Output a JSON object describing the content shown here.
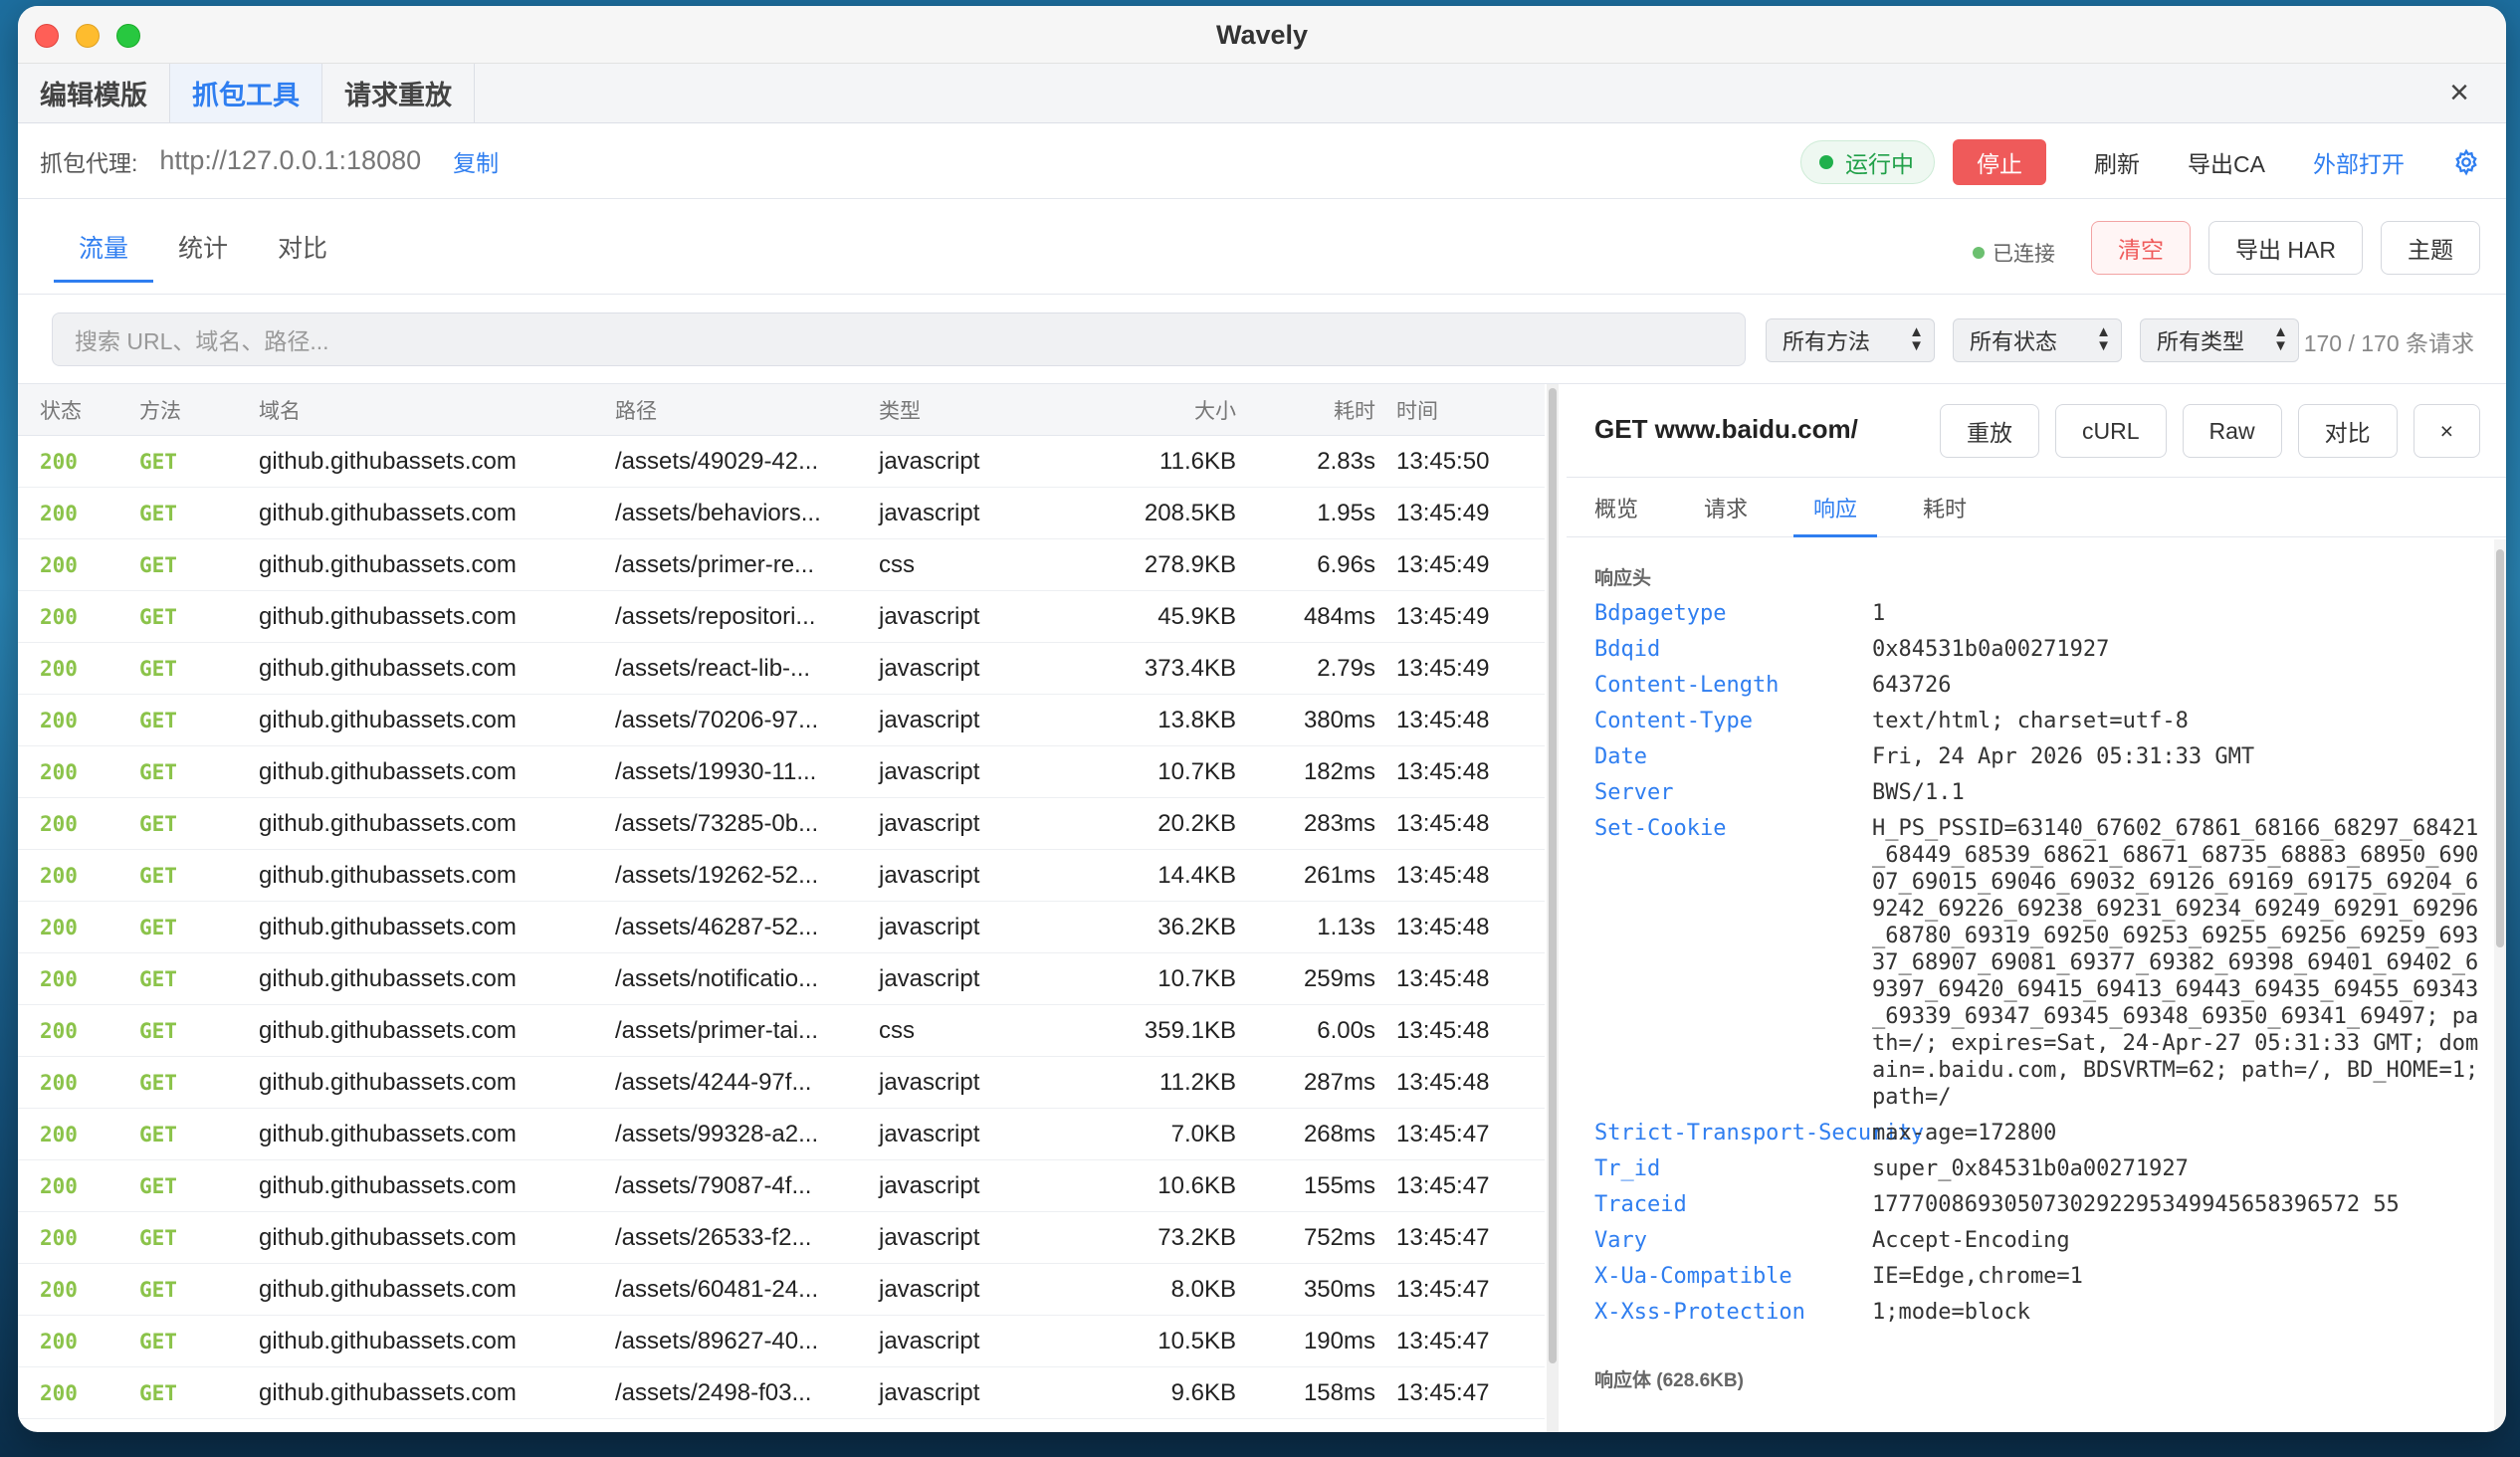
{
  "window": {
    "title": "Wavely"
  },
  "tabs": [
    {
      "label": "编辑模版",
      "active": false
    },
    {
      "label": "抓包工具",
      "active": true
    },
    {
      "label": "请求重放",
      "active": false
    }
  ],
  "proxy": {
    "label": "抓包代理:",
    "url": "http://127.0.0.1:18080",
    "copy_label": "复制",
    "status_label": "运行中",
    "stop_label": "停止",
    "refresh_label": "刷新",
    "export_ca_label": "导出CA",
    "open_external_label": "外部打开",
    "settings_icon": "gear-icon"
  },
  "subtabs": [
    {
      "label": "流量",
      "active": true
    },
    {
      "label": "统计",
      "active": false
    },
    {
      "label": "对比",
      "active": false
    }
  ],
  "toolbar": {
    "connected_label": "已连接",
    "clear_label": "清空",
    "export_har_label": "导出 HAR",
    "theme_label": "主题"
  },
  "filters": {
    "search_placeholder": "搜索 URL、域名、路径...",
    "method": "所有方法",
    "status": "所有状态",
    "type": "所有类型",
    "count_text": "170 / 170 条请求"
  },
  "table": {
    "headers": {
      "status": "状态",
      "method": "方法",
      "domain": "域名",
      "path": "路径",
      "type": "类型",
      "size": "大小",
      "duration": "耗时",
      "time": "时间"
    },
    "rows": [
      {
        "status": "200",
        "method": "GET",
        "domain": "github.githubassets.com",
        "path": "/assets/49029-42...",
        "type": "javascript",
        "size": "11.6KB",
        "duration": "2.83s",
        "time": "13:45:50"
      },
      {
        "status": "200",
        "method": "GET",
        "domain": "github.githubassets.com",
        "path": "/assets/behaviors...",
        "type": "javascript",
        "size": "208.5KB",
        "duration": "1.95s",
        "time": "13:45:49"
      },
      {
        "status": "200",
        "method": "GET",
        "domain": "github.githubassets.com",
        "path": "/assets/primer-re...",
        "type": "css",
        "size": "278.9KB",
        "duration": "6.96s",
        "time": "13:45:49"
      },
      {
        "status": "200",
        "method": "GET",
        "domain": "github.githubassets.com",
        "path": "/assets/repositori...",
        "type": "javascript",
        "size": "45.9KB",
        "duration": "484ms",
        "time": "13:45:49"
      },
      {
        "status": "200",
        "method": "GET",
        "domain": "github.githubassets.com",
        "path": "/assets/react-lib-...",
        "type": "javascript",
        "size": "373.4KB",
        "duration": "2.79s",
        "time": "13:45:49"
      },
      {
        "status": "200",
        "method": "GET",
        "domain": "github.githubassets.com",
        "path": "/assets/70206-97...",
        "type": "javascript",
        "size": "13.8KB",
        "duration": "380ms",
        "time": "13:45:48"
      },
      {
        "status": "200",
        "method": "GET",
        "domain": "github.githubassets.com",
        "path": "/assets/19930-11...",
        "type": "javascript",
        "size": "10.7KB",
        "duration": "182ms",
        "time": "13:45:48"
      },
      {
        "status": "200",
        "method": "GET",
        "domain": "github.githubassets.com",
        "path": "/assets/73285-0b...",
        "type": "javascript",
        "size": "20.2KB",
        "duration": "283ms",
        "time": "13:45:48"
      },
      {
        "status": "200",
        "method": "GET",
        "domain": "github.githubassets.com",
        "path": "/assets/19262-52...",
        "type": "javascript",
        "size": "14.4KB",
        "duration": "261ms",
        "time": "13:45:48"
      },
      {
        "status": "200",
        "method": "GET",
        "domain": "github.githubassets.com",
        "path": "/assets/46287-52...",
        "type": "javascript",
        "size": "36.2KB",
        "duration": "1.13s",
        "time": "13:45:48"
      },
      {
        "status": "200",
        "method": "GET",
        "domain": "github.githubassets.com",
        "path": "/assets/notificatio...",
        "type": "javascript",
        "size": "10.7KB",
        "duration": "259ms",
        "time": "13:45:48"
      },
      {
        "status": "200",
        "method": "GET",
        "domain": "github.githubassets.com",
        "path": "/assets/primer-tai...",
        "type": "css",
        "size": "359.1KB",
        "duration": "6.00s",
        "time": "13:45:48"
      },
      {
        "status": "200",
        "method": "GET",
        "domain": "github.githubassets.com",
        "path": "/assets/4244-97f...",
        "type": "javascript",
        "size": "11.2KB",
        "duration": "287ms",
        "time": "13:45:48"
      },
      {
        "status": "200",
        "method": "GET",
        "domain": "github.githubassets.com",
        "path": "/assets/99328-a2...",
        "type": "javascript",
        "size": "7.0KB",
        "duration": "268ms",
        "time": "13:45:47"
      },
      {
        "status": "200",
        "method": "GET",
        "domain": "github.githubassets.com",
        "path": "/assets/79087-4f...",
        "type": "javascript",
        "size": "10.6KB",
        "duration": "155ms",
        "time": "13:45:47"
      },
      {
        "status": "200",
        "method": "GET",
        "domain": "github.githubassets.com",
        "path": "/assets/26533-f2...",
        "type": "javascript",
        "size": "73.2KB",
        "duration": "752ms",
        "time": "13:45:47"
      },
      {
        "status": "200",
        "method": "GET",
        "domain": "github.githubassets.com",
        "path": "/assets/60481-24...",
        "type": "javascript",
        "size": "8.0KB",
        "duration": "350ms",
        "time": "13:45:47"
      },
      {
        "status": "200",
        "method": "GET",
        "domain": "github.githubassets.com",
        "path": "/assets/89627-40...",
        "type": "javascript",
        "size": "10.5KB",
        "duration": "190ms",
        "time": "13:45:47"
      },
      {
        "status": "200",
        "method": "GET",
        "domain": "github.githubassets.com",
        "path": "/assets/2498-f03...",
        "type": "javascript",
        "size": "9.6KB",
        "duration": "158ms",
        "time": "13:45:47"
      }
    ]
  },
  "detail": {
    "title": "GET www.baidu.com/",
    "replay_label": "重放",
    "curl_label": "cURL",
    "raw_label": "Raw",
    "compare_label": "对比",
    "close_label": "×",
    "tabs": [
      {
        "label": "概览",
        "active": false
      },
      {
        "label": "请求",
        "active": false
      },
      {
        "label": "响应",
        "active": true
      },
      {
        "label": "耗时",
        "active": false
      }
    ],
    "response_headers_title": "响应头",
    "headers": [
      {
        "key": "Bdpagetype",
        "value": "1"
      },
      {
        "key": "Bdqid",
        "value": "0x84531b0a00271927"
      },
      {
        "key": "Content-Length",
        "value": "643726"
      },
      {
        "key": "Content-Type",
        "value": "text/html; charset=utf-8"
      },
      {
        "key": "Date",
        "value": "Fri, 24 Apr 2026 05:31:33 GMT"
      },
      {
        "key": "Server",
        "value": "BWS/1.1"
      },
      {
        "key": "Set-Cookie",
        "value": "H_PS_PSSID=63140_67602_67861_68166_68297_68421_68449_68539_68621_68671_68735_68883_68950_69007_69015_69046_69032_69126_69169_69175_69204_69242_69226_69238_69231_69234_69249_69291_69296_68780_69319_69250_69253_69255_69256_69259_69337_68907_69081_69377_69382_69398_69401_69402_69397_69420_69415_69413_69443_69435_69455_69343_69339_69347_69345_69348_69350_69341_69497; path=/; expires=Sat, 24-Apr-27 05:31:33 GMT; domain=.baidu.com, BDSVRTM=62; path=/, BD_HOME=1; path=/"
      },
      {
        "key": "Strict-Transport-Security",
        "value": "max-age=172800"
      },
      {
        "key": "Tr_id",
        "value": "super_0x84531b0a00271927"
      },
      {
        "key": "Traceid",
        "value": "1777008693050730292295349945658396572 55"
      },
      {
        "key": "Vary",
        "value": "Accept-Encoding"
      },
      {
        "key": "X-Ua-Compatible",
        "value": "IE=Edge,chrome=1"
      },
      {
        "key": "X-Xss-Protection",
        "value": "1;mode=block"
      }
    ],
    "response_body_title": "响应体 (628.6KB)"
  },
  "colors": {
    "accent": "#2f7ef0",
    "danger": "#ef5a5a",
    "success": "#20a048",
    "status_ok": "#8bc34a"
  }
}
